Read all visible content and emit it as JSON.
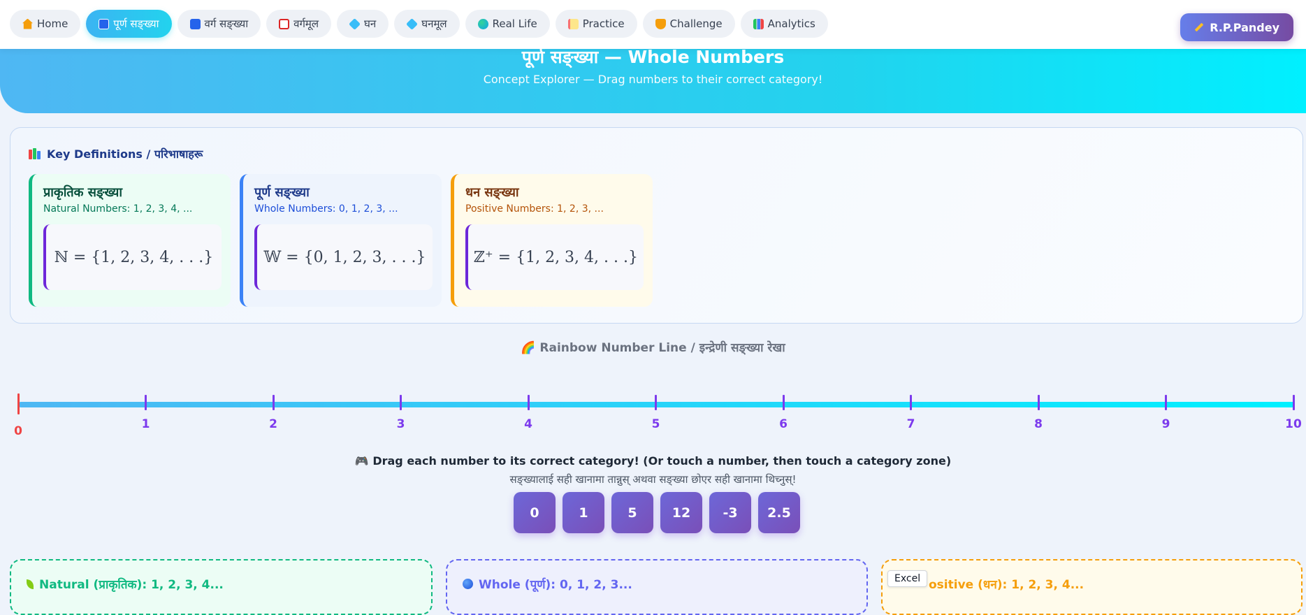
{
  "nav": {
    "tabs": [
      {
        "label": "Home",
        "icon": "house-icon",
        "active": false
      },
      {
        "label": "पूर्ण सङ्ख्या",
        "icon": "numbers-icon",
        "active": true
      },
      {
        "label": "वर्ग सङ्ख्या",
        "icon": "square-icon",
        "active": false
      },
      {
        "label": "वर्गमूल",
        "icon": "calculator-icon",
        "active": false
      },
      {
        "label": "घन",
        "icon": "cube-icon",
        "active": false
      },
      {
        "label": "घनमूल",
        "icon": "cube-icon",
        "active": false
      },
      {
        "label": "Real Life",
        "icon": "globe-icon",
        "active": false
      },
      {
        "label": "Practice",
        "icon": "memo-icon",
        "active": false
      },
      {
        "label": "Challenge",
        "icon": "trophy-icon",
        "active": false
      },
      {
        "label": "Analytics",
        "icon": "bar-chart-icon",
        "active": false
      }
    ],
    "user_label": "R.P.Pandey"
  },
  "hero": {
    "title": "पूर्ण सङ्ख्या — Whole Numbers",
    "subtitle": "Concept Explorer — Drag numbers to their correct category!"
  },
  "definitions": {
    "heading": "Key Definitions / परिभाषाहरू",
    "cards": [
      {
        "title": "प्राकृतिक सङ्ख्या",
        "subtitle": "Natural Numbers: 1, 2, 3, 4, ...",
        "formula": "ℕ = {1, 2, 3, 4, . . .}",
        "accent": "#10b981",
        "bg": "#ecfdf5",
        "title_color": "#064e3b",
        "sub_color": "#047857"
      },
      {
        "title": "पूर्ण सङ्ख्या",
        "subtitle": "Whole Numbers: 0, 1, 2, 3, ...",
        "formula": "𝕎 = {0, 1, 2, 3, . . .}",
        "accent": "#3b82f6",
        "bg": "#eef4fd",
        "title_color": "#1e3a8a",
        "sub_color": "#1d4ed8"
      },
      {
        "title": "धन सङ्ख्या",
        "subtitle": "Positive Numbers: 1, 2, 3, ...",
        "formula": "ℤ⁺ = {1, 2, 3, 4, . . .}",
        "accent": "#f59e0b",
        "bg": "#fffbeb",
        "title_color": "#78350f",
        "sub_color": "#b45309"
      }
    ]
  },
  "number_line": {
    "title": "🌈 Rainbow Number Line / इन्द्रेणी सङ्ख्या रेखा",
    "ticks": [
      "0",
      "1",
      "2",
      "3",
      "4",
      "5",
      "6",
      "7",
      "8",
      "9",
      "10"
    ]
  },
  "drag": {
    "instruction_en": "🎮 Drag each number to its correct category! (Or touch a number, then touch a category zone)",
    "instruction_ne": "सङ्ख्यालाई सही खानामा तान्नुस् अथवा सङ्ख्या छोएर सही खानामा थिच्नुस्!",
    "chips": [
      "0",
      "1",
      "5",
      "12",
      "-3",
      "2.5"
    ]
  },
  "zones": [
    {
      "label": "Natural (प्राकृतिक): 1, 2, 3, 4...",
      "icon": "seedling-icon",
      "color": "#10b981",
      "bg": "#ecfdf5"
    },
    {
      "label": "Whole (पूर्ण): 0, 1, 2, 3...",
      "icon": "blue-circle-icon",
      "color": "#6366f1",
      "bg": "#eef0fd"
    },
    {
      "label": "ositive (धन): 1, 2, 3, 4...",
      "icon": "plus-icon",
      "color": "#f59e0b",
      "bg": "#fffbeb"
    }
  ],
  "tooltip": "Excel"
}
